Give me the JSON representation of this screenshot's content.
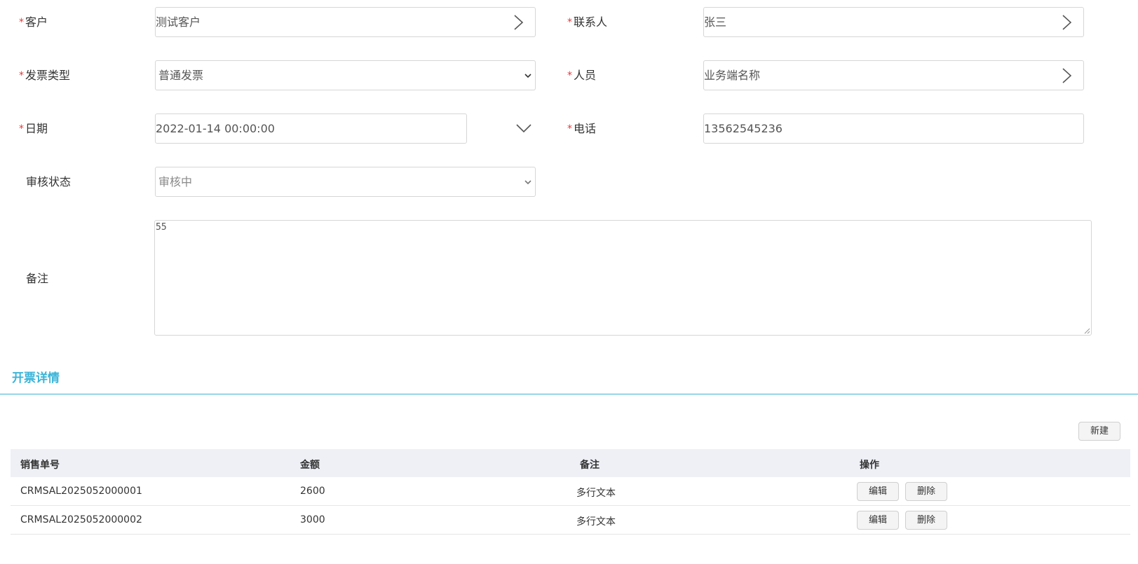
{
  "form": {
    "customer": {
      "label": "客户",
      "value": "测试客户"
    },
    "contact": {
      "label": "联系人",
      "value": "张三"
    },
    "invoice_type": {
      "label": "发票类型",
      "value": "普通发票"
    },
    "staff": {
      "label": "人员",
      "value": "业务端名称"
    },
    "date": {
      "label": "日期",
      "value": "2022-01-14 00:00:00"
    },
    "phone": {
      "label": "电话",
      "value": "13562545236"
    },
    "review_status": {
      "label": "审核状态",
      "value": "审核中"
    },
    "remark": {
      "label": "备注",
      "value": "55"
    }
  },
  "required_mark": "*",
  "section": {
    "title": "开票详情"
  },
  "new_button": "新建",
  "table": {
    "columns": [
      "销售单号",
      "金额",
      "备注",
      "操作"
    ],
    "rows": [
      {
        "order_no": "CRMSAL2025052000001",
        "amount": "2600",
        "remark": "多行文本",
        "edit": "编辑",
        "delete": "删除"
      },
      {
        "order_no": "CRMSAL2025052000002",
        "amount": "3000",
        "remark": "多行文本",
        "edit": "编辑",
        "delete": "删除"
      }
    ]
  },
  "colors": {
    "accent": "#3bb4d8",
    "required": "#e4393c",
    "header_bg": "#eef0f6"
  },
  "icons": {
    "picker": "chevron-right-icon",
    "select": "chevron-down-icon",
    "date": "chevron-down-icon"
  }
}
